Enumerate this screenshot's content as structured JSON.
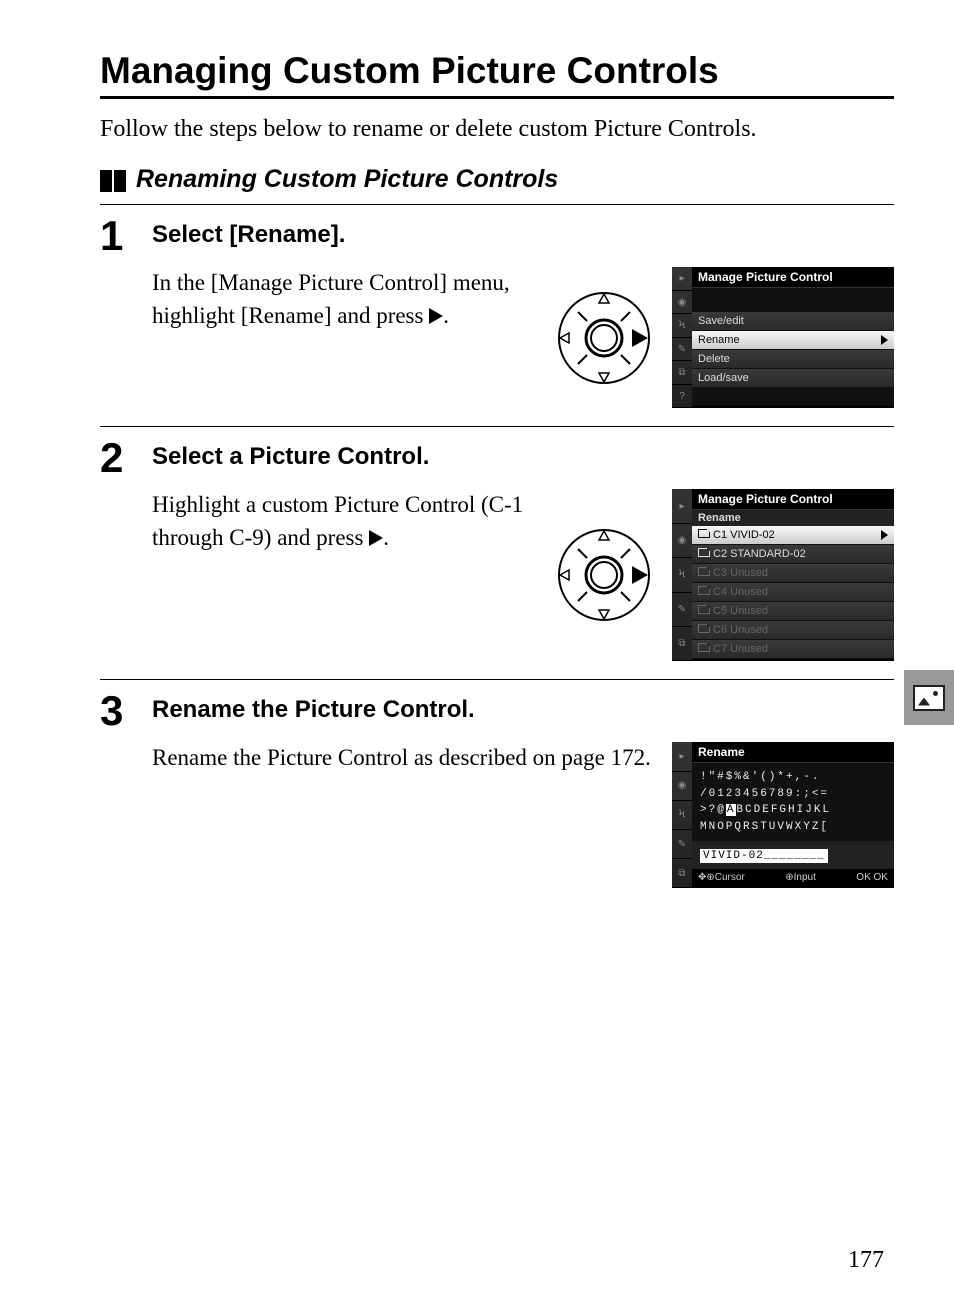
{
  "title": "Managing Custom Picture Controls",
  "intro": "Follow the steps below to rename or delete custom Picture Controls.",
  "subheading": "Renaming Custom Picture Controls",
  "steps": [
    {
      "num": "1",
      "heading": "Select [Rename].",
      "text_a": "In the [Manage Picture Control] menu, highlight [Rename] and press ",
      "text_b": "."
    },
    {
      "num": "2",
      "heading": "Select a Picture Control.",
      "text_a": "Highlight a custom Picture Control (C-1 through C-9) and press ",
      "text_b": "."
    },
    {
      "num": "3",
      "heading": "Rename the Picture Control.",
      "text_a": "Rename the Picture Control as described on page 172.",
      "text_b": ""
    }
  ],
  "lcd1": {
    "title": "Manage Picture Control",
    "items": [
      {
        "label": "Save/edit",
        "selected": false
      },
      {
        "label": "Rename",
        "selected": true
      },
      {
        "label": "Delete",
        "selected": false
      },
      {
        "label": "Load/save",
        "selected": false
      }
    ]
  },
  "lcd2": {
    "title": "Manage Picture Control",
    "sub": "Rename",
    "items": [
      {
        "slot": "C1",
        "label": "VIVID-02",
        "selected": true,
        "dim": false
      },
      {
        "slot": "C2",
        "label": "STANDARD-02",
        "selected": false,
        "dim": false
      },
      {
        "slot": "C3",
        "label": "Unused",
        "selected": false,
        "dim": true
      },
      {
        "slot": "C4",
        "label": "Unused",
        "selected": false,
        "dim": true
      },
      {
        "slot": "C5",
        "label": "Unused",
        "selected": false,
        "dim": true
      },
      {
        "slot": "C6",
        "label": "Unused",
        "selected": false,
        "dim": true
      },
      {
        "slot": "C7",
        "label": "Unused",
        "selected": false,
        "dim": true
      }
    ]
  },
  "lcd3": {
    "title": "Rename",
    "lines": {
      "l1": "!\"#$%&'()*+,-.",
      "l2a": "/0123456789:;<=",
      "l2b": ">?@",
      "l2c": "A",
      "l2d": "BCDEFGHIJKL",
      "l3": "MNOPQRSTUVWXYZ["
    },
    "input": "VIVID-02",
    "hints": {
      "cursor": "Cursor",
      "input": "Input",
      "ok": "OK"
    }
  },
  "page_number": "177"
}
